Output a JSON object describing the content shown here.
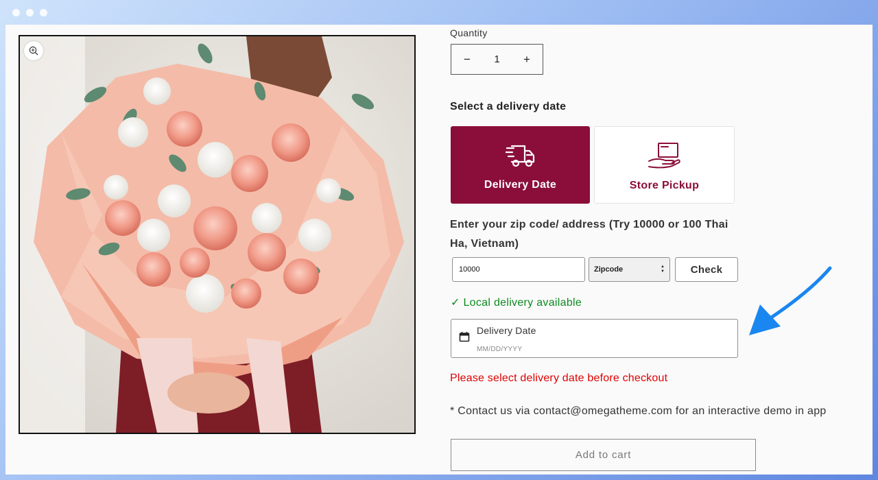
{
  "window": {
    "accent_color": "#8b0e3a"
  },
  "product_image": {
    "icons": {
      "zoom": "zoom-in-icon"
    },
    "alt": ""
  },
  "quantity": {
    "label": "Quantity",
    "decrement": "−",
    "value": "1",
    "increment": "+"
  },
  "delivery": {
    "title": "Select a delivery date",
    "options": [
      {
        "label": "Delivery Date",
        "icon": "delivery-truck-icon",
        "selected": true
      },
      {
        "label": "Store Pickup",
        "icon": "store-pickup-icon",
        "selected": false
      }
    ]
  },
  "zip": {
    "title": "Enter your zip code/ address (Try 10000 or 100 Thai Ha, Vietnam)",
    "input_value": "10000",
    "select_value": "Zipcode",
    "check_label": "Check"
  },
  "availability": {
    "text": "✓ Local delivery available",
    "color": "#0b8a1f"
  },
  "date_field": {
    "label": "Delivery Date",
    "placeholder": "MM/DD/YYYY",
    "icon": "calendar-icon"
  },
  "warning": {
    "text": "Please select delivery date before checkout",
    "color": "#e00000"
  },
  "contact": {
    "text": "* Contact us via contact@omegatheme.com for an interactive demo in app"
  },
  "cart": {
    "label": "Add to cart"
  },
  "annotation": {
    "icon": "pointer-arrow-icon",
    "color": "#1a86f0"
  }
}
